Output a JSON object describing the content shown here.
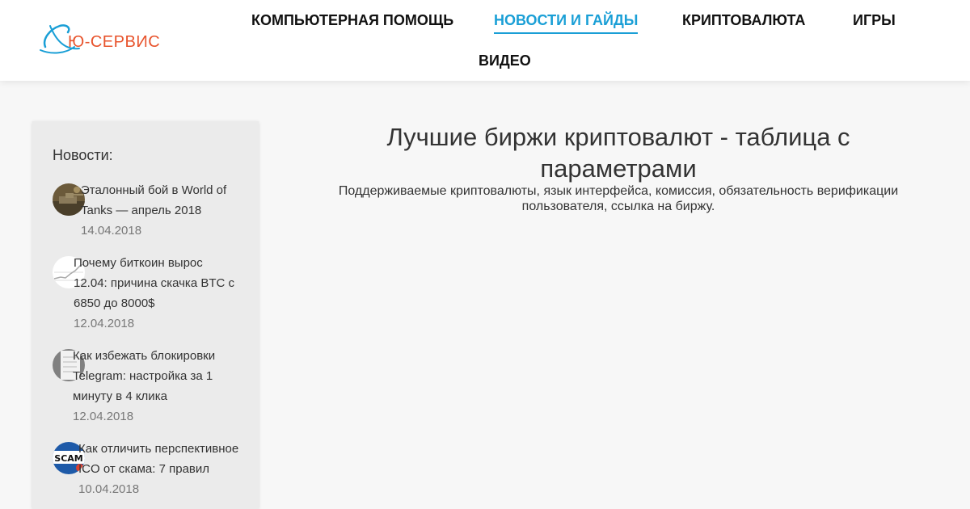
{
  "header": {
    "logo_text": "Ю-СЕРВИС",
    "nav": [
      {
        "label": "КОМПЬЮТЕРНАЯ ПОМОЩЬ",
        "active": false
      },
      {
        "label": "НОВОСТИ И ГАЙДЫ",
        "active": true
      },
      {
        "label": "КРИПТОВАЛЮТА",
        "active": false
      },
      {
        "label": "ИГРЫ",
        "active": false
      },
      {
        "label": "ВИДЕО",
        "active": false
      }
    ]
  },
  "sidebar": {
    "title": "Новости:",
    "items": [
      {
        "title": "Эталонный бой в World of Tanks — апрель 2018",
        "date": "14.04.2018",
        "icon": "tank-thumbnail-icon"
      },
      {
        "title": "Почему биткоин вырос 12.04: причина скачка BTC с 6850 до 8000$",
        "date": "12.04.2018",
        "icon": "chart-thumbnail-icon"
      },
      {
        "title": "Как избежать блокировки Telegram: настройка за 1 минуту в 4 клика",
        "date": "12.04.2018",
        "icon": "telegram-thumbnail-icon"
      },
      {
        "title": "Как отличить перспективное ICO от скама: 7 правил",
        "date": "10.04.2018",
        "icon": "scam-thumbnail-icon"
      }
    ]
  },
  "main": {
    "title": "Лучшие биржи криптовалют - таблица с параметрами",
    "subtitle": "Поддерживаемые криптовалюты, язык интерфейса, комиссия, обязательность верификации пользователя, ссылка на биржу."
  },
  "colors": {
    "accent": "#1a9fd6",
    "logo_orange": "#e8542d",
    "sidebar_bg": "#ebebeb"
  }
}
